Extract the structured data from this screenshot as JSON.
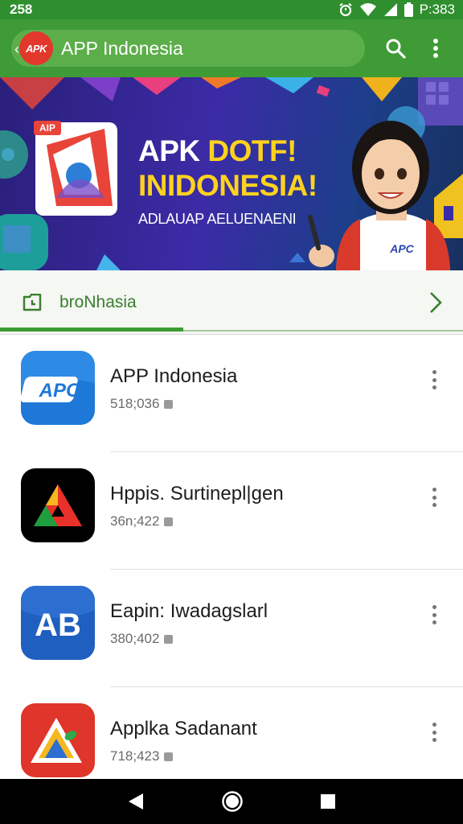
{
  "status_bar": {
    "time_left": "258",
    "time_right": "P:383"
  },
  "app_bar": {
    "logo_text": "APK",
    "title": "APP Indonesia",
    "icons": [
      "back-arrow-icon",
      "search-icon",
      "more-vert-icon"
    ]
  },
  "banner": {
    "headline_part1": "APK ",
    "headline_part2": "DOTF!",
    "headline_line2": "INIDONESIA!",
    "subtitle": "ADLAUAP AELUENAENI",
    "badge_text": "AIP",
    "mascot_badge": "APC"
  },
  "category": {
    "label": "broNhasia",
    "icon": "folder-clock-icon"
  },
  "apps": [
    {
      "name": "APP Indonesia",
      "meta": "518;036",
      "icon_text": "APC",
      "icon_bg": "#1e78d8"
    },
    {
      "name": "Hppis. Surtinepl|gen",
      "meta": "36n;422",
      "icon_text": "",
      "icon_bg": "#000000"
    },
    {
      "name": "Eapin: Iwadagslarl",
      "meta": "380;402",
      "icon_text": "AB",
      "icon_bg": "#1f5fbf"
    },
    {
      "name": "Applka Sadanant",
      "meta": "718;423",
      "icon_text": "",
      "icon_bg": "#e0352a"
    }
  ],
  "colors": {
    "primary": "#3e9b35",
    "status_bar": "#2f8f2f",
    "accent_yellow": "#ffd21e"
  }
}
